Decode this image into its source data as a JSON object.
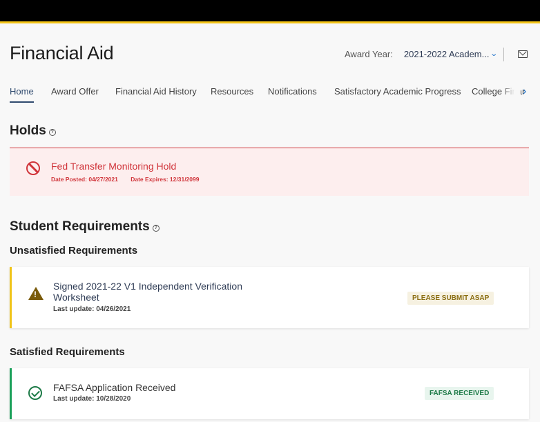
{
  "header": {
    "title": "Financial Aid",
    "award_year_label": "Award Year:",
    "award_year_value": "2021-2022 Academ...",
    "mail_icon": "envelope-icon"
  },
  "tabs": [
    {
      "label": "Home",
      "active": true
    },
    {
      "label": "Award Offer",
      "active": false
    },
    {
      "label": "Financial Aid History",
      "active": false
    },
    {
      "label": "Resources",
      "active": false
    },
    {
      "label": "Notifications",
      "active": false
    },
    {
      "label": "Satisfactory Academic Progress",
      "active": false
    },
    {
      "label": "College Finar",
      "active": false
    }
  ],
  "holds": {
    "title": "Holds",
    "items": [
      {
        "name": "Fed Transfer Monitoring Hold",
        "date_posted": "Date Posted: 04/27/2021",
        "date_expires": "Date Expires: 12/31/2099",
        "icon": "prohibited-icon"
      }
    ]
  },
  "requirements": {
    "title": "Student Requirements",
    "unsatisfied": {
      "title": "Unsatisfied Requirements",
      "items": [
        {
          "name": "Signed 2021-22 V1 Independent Verification Worksheet",
          "last_update": "Last update: 04/26/2021",
          "status": "PLEASE SUBMIT ASAP",
          "icon": "warning-icon"
        }
      ]
    },
    "satisfied": {
      "title": "Satisfied Requirements",
      "items": [
        {
          "name": "FAFSA Application Received",
          "last_update": "Last update: 10/28/2020",
          "status": "FAFSA RECEIVED",
          "icon": "check-circle-icon"
        }
      ]
    }
  },
  "colors": {
    "accent_bar": "#f5c518",
    "hold_red": "#d0343a",
    "warning_yellow": "#f0c419",
    "success_green": "#1aa05a",
    "link_blue": "#1a6fc9"
  }
}
